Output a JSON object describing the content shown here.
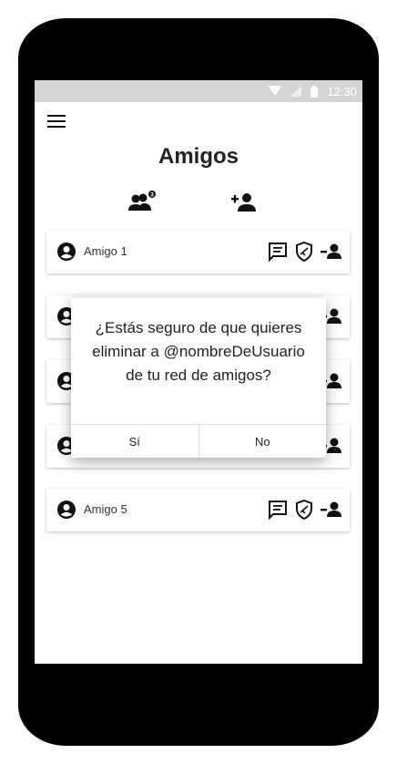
{
  "status_bar": {
    "time": "12:30"
  },
  "header": {
    "title": "Amigos",
    "requests_badge": "3"
  },
  "friends": [
    {
      "name": "Amigo 1"
    },
    {
      "name": ""
    },
    {
      "name": ""
    },
    {
      "name": ""
    },
    {
      "name": "Amigo 5"
    }
  ],
  "dialog": {
    "message": "¿Estás seguro de que quieres eliminar a @nombreDeUsuario de tu red de amigos?",
    "yes_label": "Sí",
    "no_label": "No"
  },
  "colors": {
    "status_bar": "#d4d4d4",
    "frame": "#000000",
    "text": "#222222"
  },
  "icons": [
    "menu-icon",
    "friend-requests-icon",
    "add-friend-icon",
    "account-circle-icon",
    "chat-icon",
    "shield-icon",
    "remove-friend-icon"
  ]
}
